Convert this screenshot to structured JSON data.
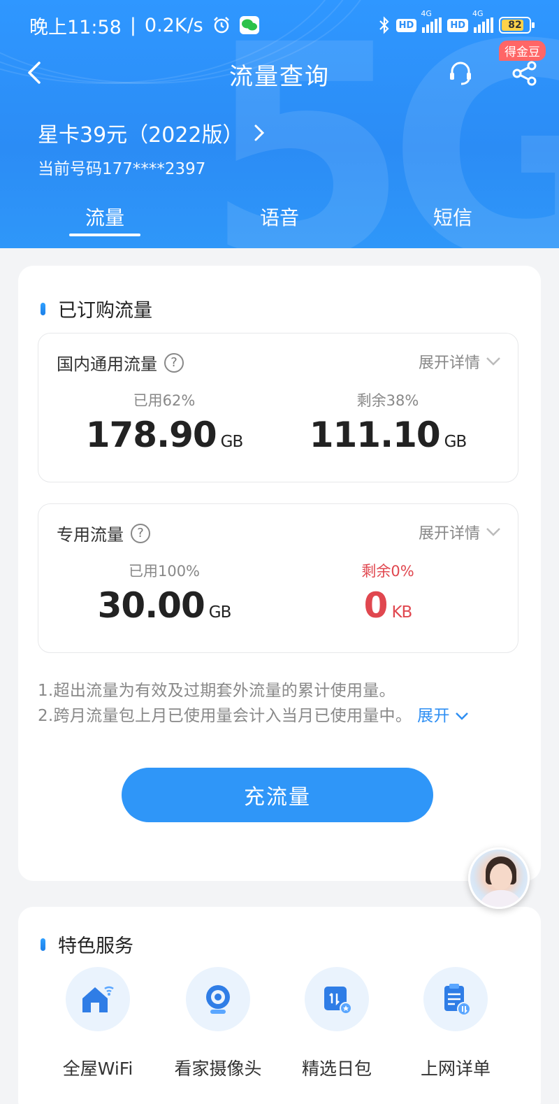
{
  "status_bar": {
    "time": "晚上11:58",
    "network_speed": "0.2K/s",
    "battery": "82"
  },
  "header": {
    "title": "流量查询",
    "badge": "得金豆",
    "plan_name": "星卡39元（2022版）",
    "phone": "当前号码177****2397",
    "tabs": [
      "流量",
      "语音",
      "短信"
    ],
    "active_tab": "流量"
  },
  "subscribed": {
    "section_title": "已订购流量",
    "domestic": {
      "title": "国内通用流量",
      "expand_label": "展开详情",
      "used_label": "已用62%",
      "used_value": "178.90",
      "used_unit": "GB",
      "remain_label": "剩余38%",
      "remain_value": "111.10",
      "remain_unit": "GB"
    },
    "dedicated": {
      "title": "专用流量",
      "expand_label": "展开详情",
      "used_label": "已用100%",
      "used_value": "30.00",
      "used_unit": "GB",
      "remain_label": "剩余0%",
      "remain_value": "0",
      "remain_unit": "KB"
    },
    "notes": [
      "1.超出流量为有效及过期套外流量的累计使用量。",
      "2.跨月流量包上月已使用量会计入当月已使用量中。"
    ],
    "notes_more": "展开",
    "recharge_button": "充流量"
  },
  "services": {
    "section_title": "特色服务",
    "items": [
      {
        "label": "全屋WiFi",
        "icon": "home-wifi-icon"
      },
      {
        "label": "看家摄像头",
        "icon": "camera-icon"
      },
      {
        "label": "精选日包",
        "icon": "daily-pack-icon"
      },
      {
        "label": "上网详单",
        "icon": "usage-list-icon"
      }
    ]
  },
  "colors": {
    "brand_blue": "#2f96f8",
    "alert_red": "#e0474f",
    "badge_red": "#ff6666"
  }
}
